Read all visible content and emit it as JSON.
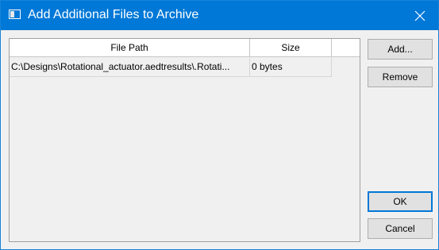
{
  "window": {
    "title": "Add Additional Files to Archive"
  },
  "table": {
    "columns": [
      "File Path",
      "Size"
    ],
    "rows": [
      {
        "path": "C:\\Designs\\Rotational_actuator.aedtresults\\.Rotati...",
        "size": "0 bytes"
      }
    ]
  },
  "buttons": {
    "add": "Add...",
    "remove": "Remove",
    "ok": "OK",
    "cancel": "Cancel"
  },
  "icons": {
    "app": "window-icon",
    "close": "close-icon"
  },
  "colors": {
    "titlebar": "#0078d7",
    "accent": "#0078d7"
  }
}
